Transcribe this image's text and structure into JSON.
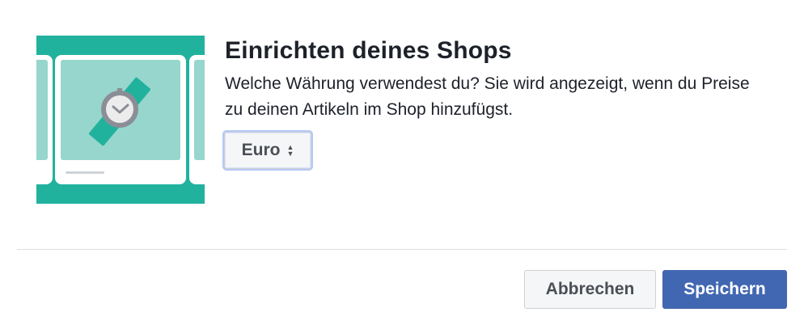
{
  "dialog": {
    "title": "Einrichten deines Shops",
    "description": "Welche Währung verwendest du? Sie wird angezeigt, wenn du Preise zu deinen Artikeln im Shop hinzufügst.",
    "currency_select": {
      "selected": "Euro"
    },
    "buttons": {
      "cancel": "Abbrechen",
      "save": "Speichern"
    }
  },
  "illustration": {
    "icon": "watch-icon"
  },
  "colors": {
    "illustration_bg": "#21b29e",
    "card_screen": "#97d6cc",
    "primary_button": "#4267b2",
    "text": "#1d2129"
  }
}
